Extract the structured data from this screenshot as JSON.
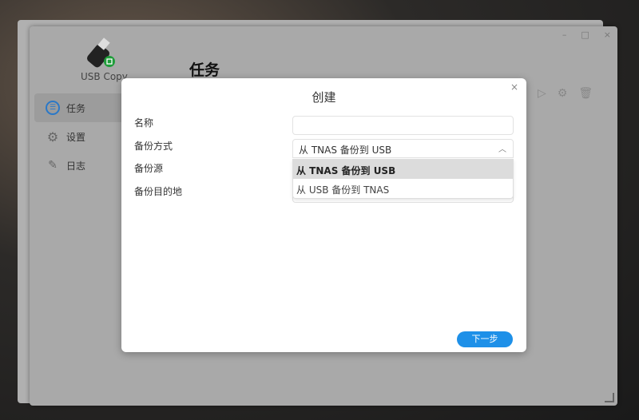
{
  "app": {
    "name": "USB Copy",
    "page_title": "任务",
    "window_controls": {
      "minimize": "–",
      "maximize": "□",
      "close": "×"
    }
  },
  "sidebar": {
    "items": [
      {
        "label": "任务",
        "icon": "tasks-icon",
        "active": true
      },
      {
        "label": "设置",
        "icon": "gear-icon"
      },
      {
        "label": "日志",
        "icon": "log-icon"
      }
    ]
  },
  "toolbar": {
    "icons": [
      "play-icon",
      "settings-icon",
      "trash-icon"
    ]
  },
  "modal": {
    "title": "创建",
    "close": "×",
    "fields": [
      {
        "label": "名称",
        "value": ""
      },
      {
        "label": "备份方式",
        "value": "从 TNAS 备份到 USB"
      },
      {
        "label": "备份源"
      },
      {
        "label": "备份目的地"
      }
    ],
    "dropdown_options": [
      "从 TNAS 备份到 USB",
      "从 USB 备份到 TNAS"
    ],
    "next_label": "下一步"
  },
  "colors": {
    "accent": "#1e90e8"
  }
}
